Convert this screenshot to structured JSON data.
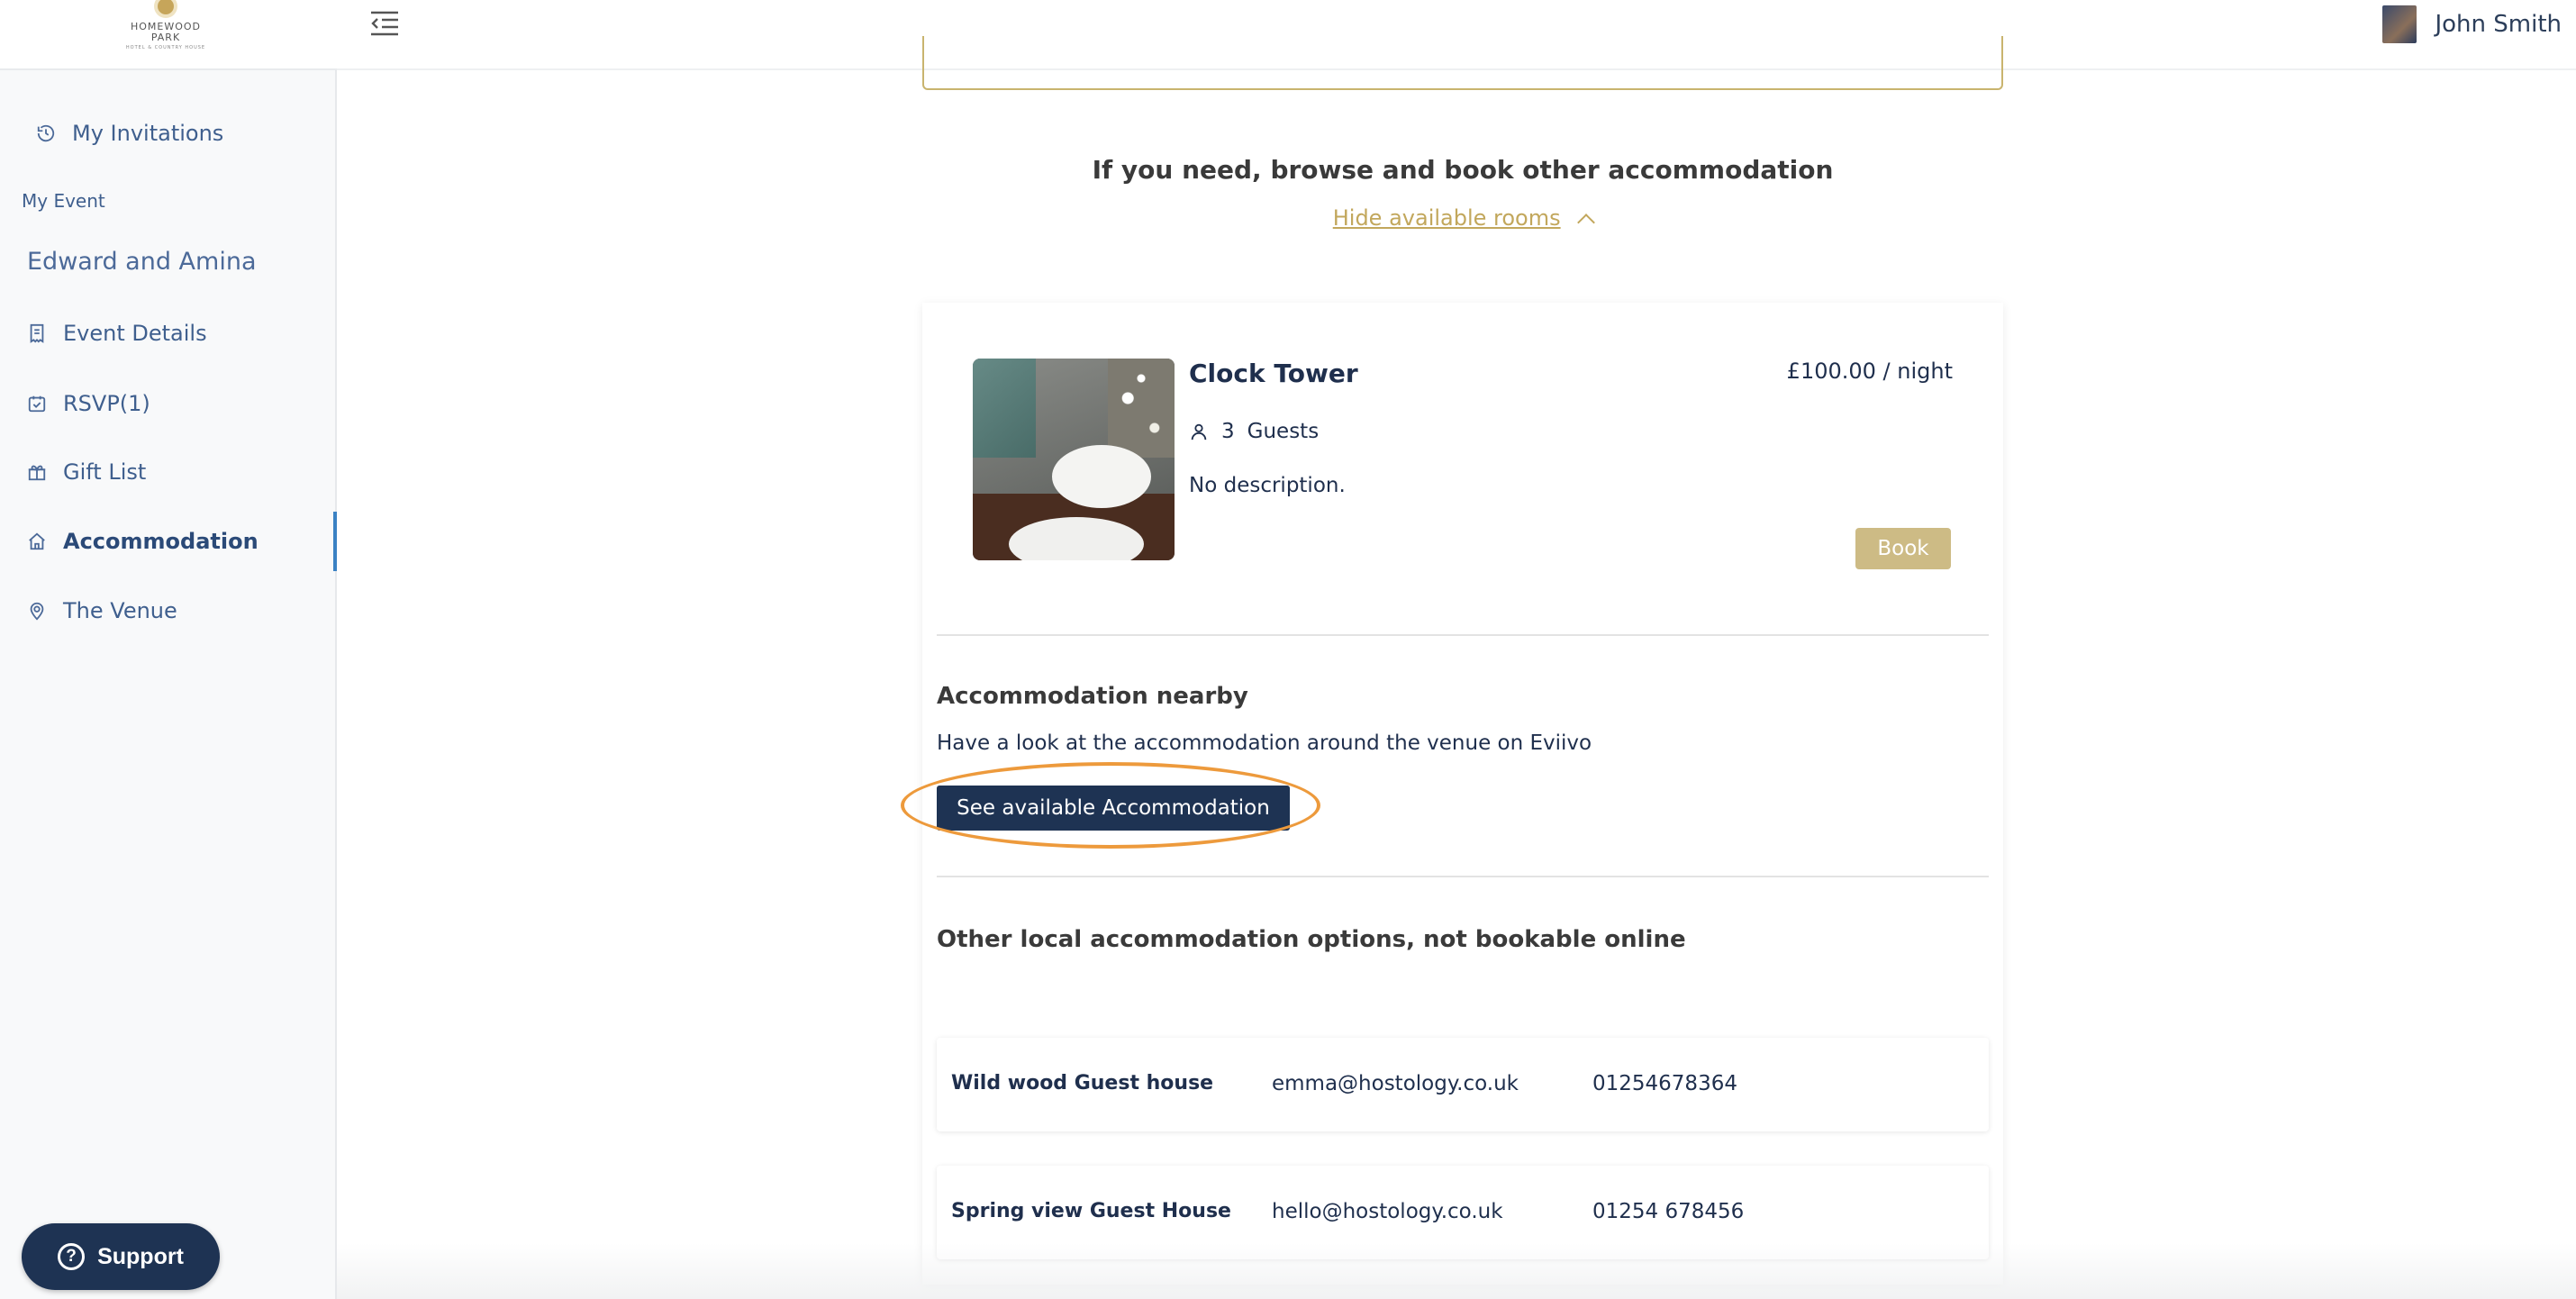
{
  "app": {
    "logo_name": "HOMEWOOD PARK",
    "logo_sub": "HOTEL & COUNTRY HOUSE"
  },
  "sidebar": {
    "my_invitations": "My Invitations",
    "section_label": "My Event",
    "event_name": "Edward and Amina",
    "items": [
      {
        "label": "Event Details",
        "icon": "receipt-icon"
      },
      {
        "label": "RSVP(1)",
        "icon": "calendar-check-icon"
      },
      {
        "label": "Gift List",
        "icon": "gift-icon"
      },
      {
        "label": "Accommodation",
        "icon": "home-icon",
        "active": true
      },
      {
        "label": "The Venue",
        "icon": "location-pin-icon"
      }
    ],
    "support_label": "Support"
  },
  "header": {
    "user_name": "John Smith"
  },
  "main": {
    "browse_title": "If you need, browse and book other accommodation",
    "hide_rooms_link": "Hide available rooms",
    "room": {
      "title": "Clock Tower",
      "guests_count": "3",
      "guests_label": "Guests",
      "description": "No description.",
      "price": "£100.00 / night",
      "book_label": "Book"
    },
    "nearby": {
      "title": "Accommodation nearby",
      "text": "Have a look at the accommodation around the venue on Eviivo",
      "button_label": "See available Accommodation"
    },
    "other": {
      "title": "Other local accommodation options, not bookable online",
      "options": [
        {
          "name": "Wild wood Guest house",
          "email": "emma@hostology.co.uk",
          "phone": "01254678364"
        },
        {
          "name": "Spring view Guest House",
          "email": "hello@hostology.co.uk",
          "phone": "01254 678456"
        }
      ]
    }
  },
  "colors": {
    "accent_gold": "#c2a75c",
    "navy": "#1e3353",
    "highlight_orange": "#ed9a3c",
    "active_bar": "#3b82c4"
  }
}
